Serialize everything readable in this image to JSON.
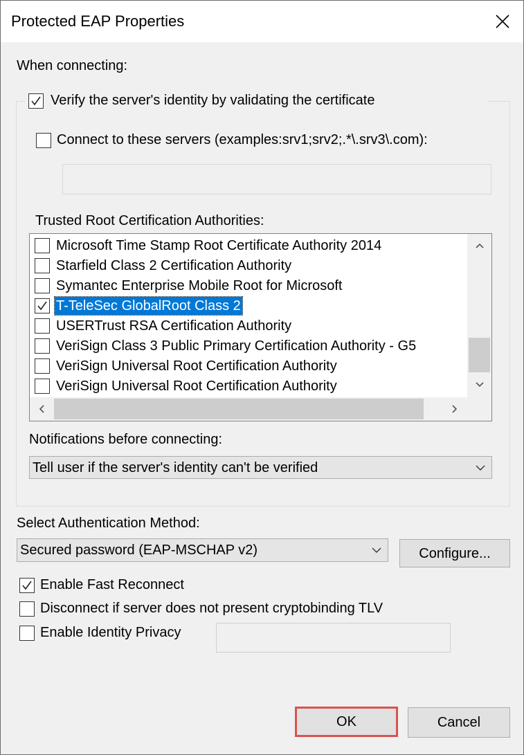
{
  "window": {
    "title": "Protected EAP Properties"
  },
  "when_connecting_label": "When connecting:",
  "verify_checkbox": {
    "label": "Verify the server's identity by validating the certificate",
    "checked": true
  },
  "connect_servers": {
    "label": "Connect to these servers (examples:srv1;srv2;.*\\.srv3\\.com):",
    "checked": false,
    "value": ""
  },
  "trusted_root_label": "Trusted Root Certification Authorities:",
  "cert_list": [
    {
      "label": "Microsoft Time Stamp Root Certificate Authority 2014",
      "checked": false
    },
    {
      "label": "Starfield Class 2 Certification Authority",
      "checked": false
    },
    {
      "label": "Symantec Enterprise Mobile Root for Microsoft",
      "checked": false
    },
    {
      "label": "T-TeleSec GlobalRoot Class 2",
      "checked": true,
      "selected": true
    },
    {
      "label": "USERTrust RSA Certification Authority",
      "checked": false
    },
    {
      "label": "VeriSign Class 3 Public Primary Certification Authority - G5",
      "checked": false
    },
    {
      "label": "VeriSign Universal Root Certification Authority",
      "checked": false
    },
    {
      "label": "VeriSign Universal Root Certification Authority",
      "checked": false
    }
  ],
  "notifications_label": "Notifications before connecting:",
  "notifications_select": {
    "value": "Tell user if the server's identity can't be verified"
  },
  "auth_method_label": "Select Authentication Method:",
  "auth_method_select": {
    "value": "Secured password (EAP-MSCHAP v2)"
  },
  "configure_button": "Configure...",
  "fast_reconnect": {
    "label": "Enable Fast Reconnect",
    "checked": true
  },
  "cryptobinding": {
    "label": "Disconnect if server does not present cryptobinding TLV",
    "checked": false
  },
  "identity_privacy": {
    "label": "Enable Identity Privacy",
    "checked": false,
    "value": ""
  },
  "ok_button": "OK",
  "cancel_button": "Cancel",
  "colors": {
    "selection": "#0078d7",
    "ok_highlight": "#d9534f"
  }
}
